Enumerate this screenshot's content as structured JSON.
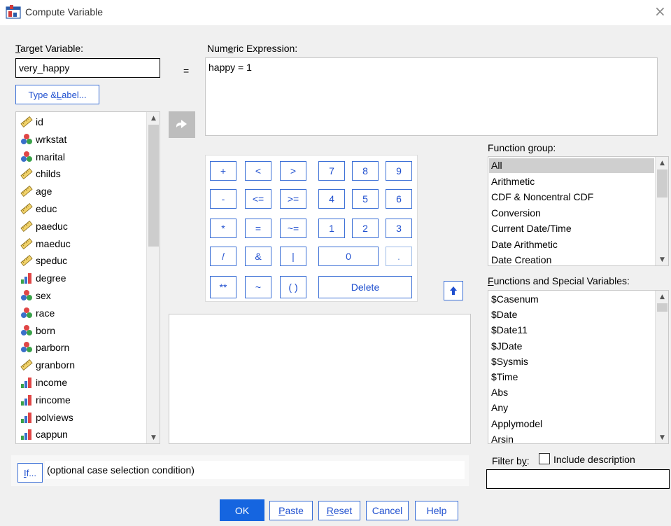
{
  "window": {
    "title": "Compute Variable",
    "close_glyph": "×"
  },
  "target": {
    "label_pre": "",
    "label_u": "T",
    "label_post": "arget Variable:",
    "value": "very_happy",
    "type_label_pre": "Type & ",
    "type_label_u": "L",
    "type_label_post": "abel..."
  },
  "equals": "=",
  "expression": {
    "label_pre": "Num",
    "label_u": "e",
    "label_post": "ric Expression:",
    "value": "happy = 1"
  },
  "variables": [
    {
      "name": "id",
      "icon": "scale-ruler-icon"
    },
    {
      "name": "wrkstat",
      "icon": "nominal-icon"
    },
    {
      "name": "marital",
      "icon": "nominal-icon"
    },
    {
      "name": "childs",
      "icon": "scale-ruler-icon"
    },
    {
      "name": "age",
      "icon": "scale-ruler-icon"
    },
    {
      "name": "educ",
      "icon": "scale-ruler-icon"
    },
    {
      "name": "paeduc",
      "icon": "scale-ruler-icon"
    },
    {
      "name": "maeduc",
      "icon": "scale-ruler-icon"
    },
    {
      "name": "speduc",
      "icon": "scale-ruler-icon"
    },
    {
      "name": "degree",
      "icon": "ordinal-icon"
    },
    {
      "name": "sex",
      "icon": "nominal-icon"
    },
    {
      "name": "race",
      "icon": "nominal-icon"
    },
    {
      "name": "born",
      "icon": "nominal-icon"
    },
    {
      "name": "parborn",
      "icon": "nominal-icon"
    },
    {
      "name": "granborn",
      "icon": "scale-ruler-icon"
    },
    {
      "name": "income",
      "icon": "ordinal-icon"
    },
    {
      "name": "rincome",
      "icon": "ordinal-icon"
    },
    {
      "name": "polviews",
      "icon": "ordinal-icon"
    },
    {
      "name": "cappun",
      "icon": "ordinal-icon"
    }
  ],
  "keypad": {
    "plus": "+",
    "lt": "<",
    "gt": ">",
    "k7": "7",
    "k8": "8",
    "k9": "9",
    "minus": "-",
    "le": "<=",
    "ge": ">=",
    "k4": "4",
    "k5": "5",
    "k6": "6",
    "times": "*",
    "eq": "=",
    "ne": "~=",
    "k1": "1",
    "k2": "2",
    "k3": "3",
    "div": "/",
    "and": "&",
    "or": "|",
    "k0": "0",
    "dot": ".",
    "pow": "**",
    "not": "~",
    "paren": "( )",
    "delete": "Delete"
  },
  "function_group": {
    "label": "Function group:",
    "items": [
      "All",
      "Arithmetic",
      "CDF & Noncentral CDF",
      "Conversion",
      "Current Date/Time",
      "Date Arithmetic",
      "Date Creation"
    ],
    "selected": "All"
  },
  "functions": {
    "label_pre": "",
    "label_u": "F",
    "label_post": "unctions and Special Variables:",
    "items": [
      "$Casenum",
      "$Date",
      "$Date11",
      "$JDate",
      "$Sysmis",
      "$Time",
      "Abs",
      "Any",
      "Applymodel",
      "Arsin"
    ]
  },
  "if_section": {
    "btn_u": "I",
    "btn_post": "f...",
    "text": "(optional case selection condition)"
  },
  "filter": {
    "label_pre": "Filter b",
    "label_u": "y",
    "label_post": ":",
    "checkbox_label": "Include description",
    "value": ""
  },
  "buttons": {
    "ok": "OK",
    "paste_u": "P",
    "paste_post": "aste",
    "reset_u": "R",
    "reset_post": "eset",
    "cancel": "Cancel",
    "help": "Help"
  },
  "colors": {
    "accent": "#1565e0",
    "button_border": "#3b6fd6",
    "selected_row": "#cfcfcf"
  }
}
